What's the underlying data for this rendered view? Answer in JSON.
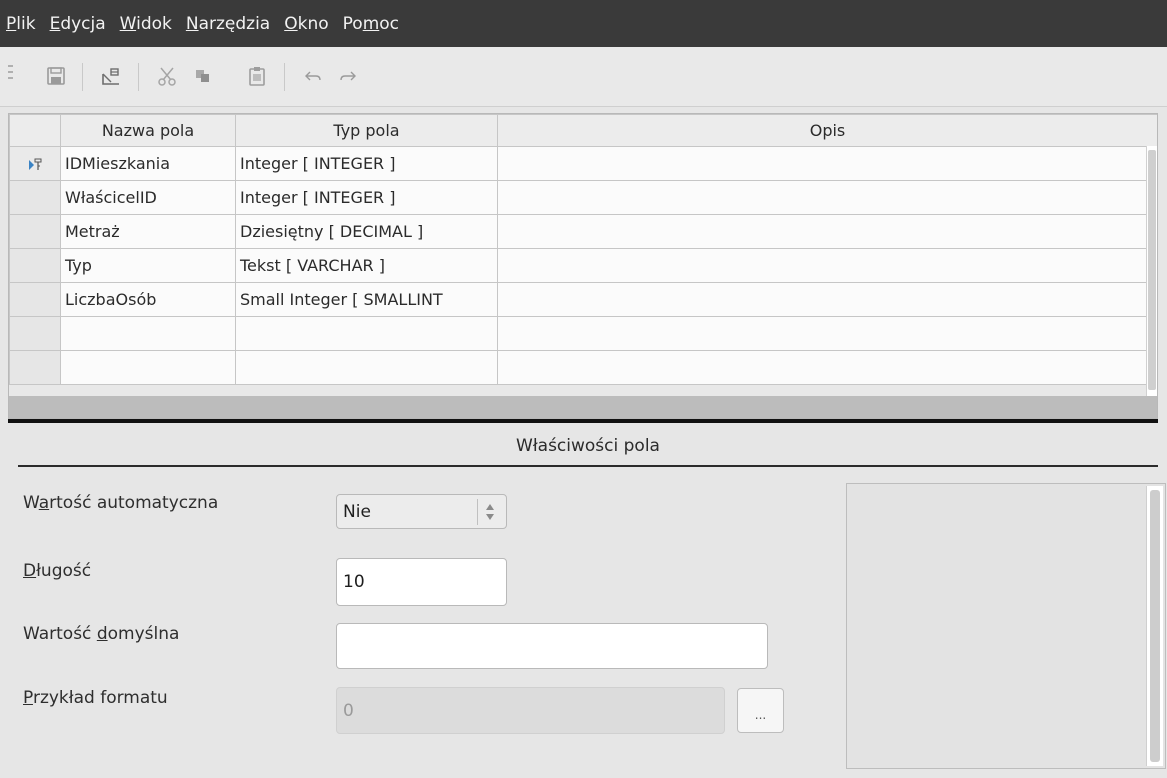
{
  "menu": [
    {
      "pre": "",
      "u": "P",
      "post": "lik"
    },
    {
      "pre": "",
      "u": "E",
      "post": "dycja"
    },
    {
      "pre": "",
      "u": "W",
      "post": "idok"
    },
    {
      "pre": "",
      "u": "N",
      "post": "arzędzia"
    },
    {
      "pre": "",
      "u": "O",
      "post": "kno"
    },
    {
      "pre": "Po",
      "u": "m",
      "post": "oc"
    }
  ],
  "toolbar": {
    "icons": [
      "save-icon",
      "table-index-icon",
      "cut-icon",
      "copy-icon",
      "paste-icon",
      "undo-icon",
      "redo-icon"
    ]
  },
  "table": {
    "columns": {
      "name": "Nazwa pola",
      "type": "Typ pola",
      "desc": "Opis"
    },
    "rows": [
      {
        "name": "IDMieszkania",
        "type": "Integer [ INTEGER ]",
        "desc": "",
        "primary_key": true
      },
      {
        "name": "WłaścicelID",
        "type": "Integer [ INTEGER ]",
        "desc": ""
      },
      {
        "name": "Metraż",
        "type": "Dziesiętny [ DECIMAL ]",
        "desc": ""
      },
      {
        "name": "Typ",
        "type": "Tekst [ VARCHAR ]",
        "desc": ""
      },
      {
        "name": "LiczbaOsób",
        "type": "Small Integer [ SMALLINT",
        "desc": ""
      },
      {
        "name": "",
        "type": "",
        "desc": ""
      },
      {
        "name": "",
        "type": "",
        "desc": ""
      }
    ]
  },
  "properties": {
    "title": "Właściwości pola",
    "auto_value": {
      "label_pre": "W",
      "label_u": "a",
      "label_post": "rtość automatyczna",
      "value": "Nie"
    },
    "length": {
      "label_pre": "",
      "label_u": "D",
      "label_post": "ługość",
      "value": "10"
    },
    "default": {
      "label_pre": "Wartość ",
      "label_u": "d",
      "label_post": "omyślna",
      "value": ""
    },
    "format": {
      "label_pre": "",
      "label_u": "P",
      "label_post": "rzykład formatu",
      "value": "0",
      "button": "..."
    }
  },
  "colors": {
    "menubar": "#3a3a3a",
    "accent": "#3b83c4"
  }
}
